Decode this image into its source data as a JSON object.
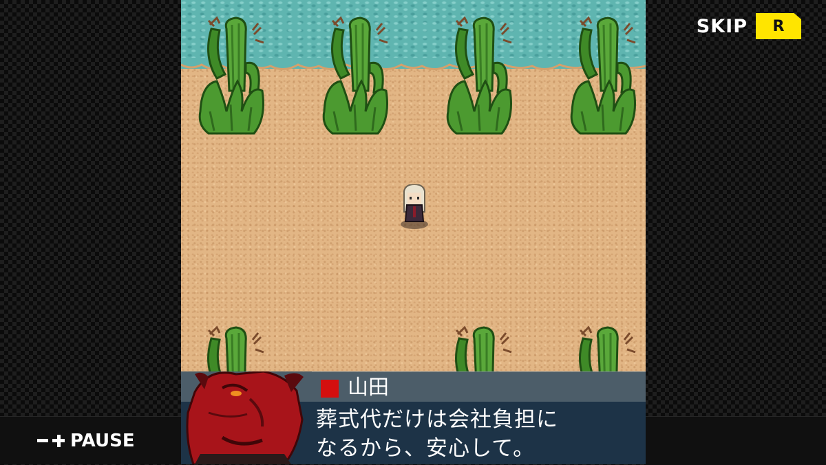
{
  "controls": {
    "skip_label": "SKIP",
    "skip_key": "R",
    "pause_label": "PAUSE"
  },
  "dialog": {
    "speaker": "山田",
    "lines": [
      "葬式代だけは会社負担に",
      "なるから、安心して。"
    ]
  },
  "colors": {
    "skip_key": "#ffe500",
    "name_marker": "#d40f0f",
    "dialog_bg": "#1d3347",
    "name_strip_bg": "#4c5d69",
    "sand": "#e2b685",
    "water": "#5fb5b0",
    "cactus": "#4c9a30"
  },
  "icons": [
    "minus-icon",
    "plus-icon",
    "cactus",
    "player-character",
    "demon-portrait"
  ]
}
